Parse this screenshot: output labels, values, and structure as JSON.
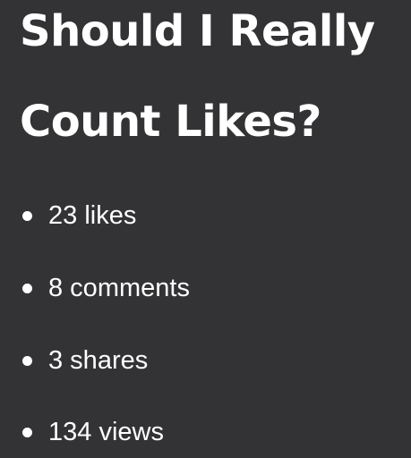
{
  "slide": {
    "title_line_1": "Should I Really",
    "title_line_2": "Count Likes?",
    "bullets": [
      {
        "text": "23 likes"
      },
      {
        "text": "8 comments"
      },
      {
        "text": "3 shares"
      },
      {
        "text": "134 views"
      }
    ],
    "colors": {
      "background": "#333335",
      "text": "#ffffff"
    }
  }
}
